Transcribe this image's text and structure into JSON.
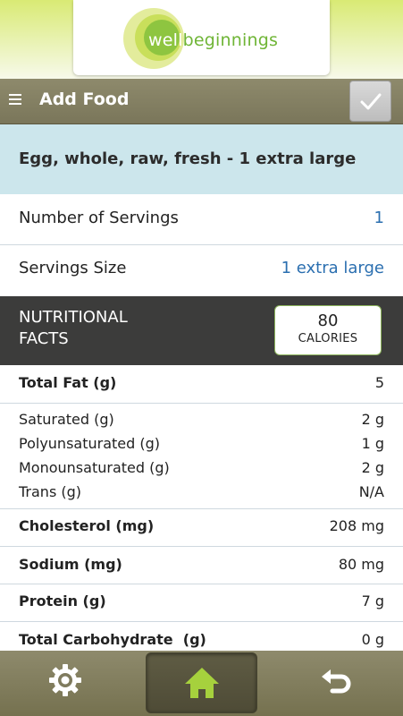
{
  "logo": {
    "part1": "well",
    "part2": "beginnings"
  },
  "header": {
    "title": "Add Food",
    "menu_icon": "hamburger-menu-icon",
    "confirm_icon": "checkmark-icon"
  },
  "food": {
    "name": "Egg, whole, raw, fresh - 1 extra large"
  },
  "servings": {
    "number_label": "Number of Servings",
    "number_value": "1",
    "size_label": "Servings Size",
    "size_value": "1 extra large"
  },
  "nutrition": {
    "heading_line1": "NUTRITIONAL",
    "heading_line2": "FACTS",
    "calories_value": "80",
    "calories_unit": "CALORIES",
    "total_fat_label": "Total Fat (g)",
    "total_fat_value": "5",
    "saturated_label": "Saturated (g)",
    "saturated_value": "2 g",
    "poly_label": "Polyunsaturated (g)",
    "poly_value": "1 g",
    "mono_label": "Monounsaturated (g)",
    "mono_value": "2 g",
    "trans_label": "Trans (g)",
    "trans_value": "N/A",
    "cholesterol_label": "Cholesterol (mg)",
    "cholesterol_value": "208 mg",
    "sodium_label": "Sodium (mg)",
    "sodium_value": "80 mg",
    "protein_label": "Protein (g)",
    "protein_value": "7 g",
    "carb_label": "Total Carbohydrate  (g)",
    "carb_value": "0 g"
  },
  "bottom_nav": {
    "left_icon": "gear-icon",
    "center_icon": "home-icon",
    "right_icon": "undo-back-icon"
  },
  "colors": {
    "accent_blue": "#2b6fb0",
    "brand_green": "#8bc34a",
    "bar_olive": "#857f63"
  }
}
